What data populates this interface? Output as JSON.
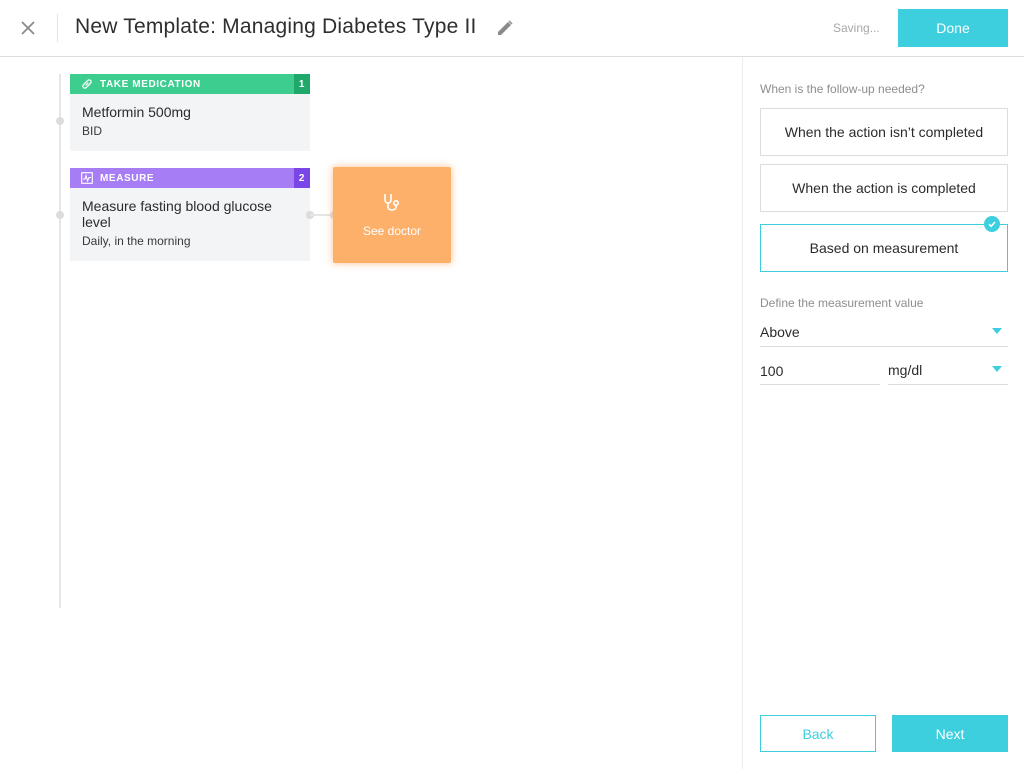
{
  "header": {
    "title": "New Template: Managing Diabetes Type II",
    "status": "Saving...",
    "done_label": "Done"
  },
  "canvas": {
    "cards": [
      {
        "type_label": "TAKE MEDICATION",
        "number": "1",
        "title": "Metformin 500mg",
        "subtitle": "BID",
        "icon": "pill-icon",
        "color": "#3ccd8f"
      },
      {
        "type_label": "MEASURE",
        "number": "2",
        "title": "Measure fasting blood glucose level",
        "subtitle": "Daily, in the morning",
        "icon": "pulse-chart-icon",
        "color": "#a77df5"
      }
    ],
    "follow_up": {
      "label": "See doctor",
      "icon": "stethoscope-icon",
      "color": "#fdb06a"
    }
  },
  "panel": {
    "question": "When is the follow-up needed?",
    "options": [
      "When the action isn’t completed",
      "When the action is completed",
      "Based on measurement"
    ],
    "selected_option": "Based on measurement",
    "measurement_label": "Define the measurement value",
    "comparator": "Above",
    "value": "100",
    "unit": "mg/dl",
    "back_label": "Back",
    "next_label": "Next"
  },
  "colors": {
    "accent": "#3dcfde"
  }
}
